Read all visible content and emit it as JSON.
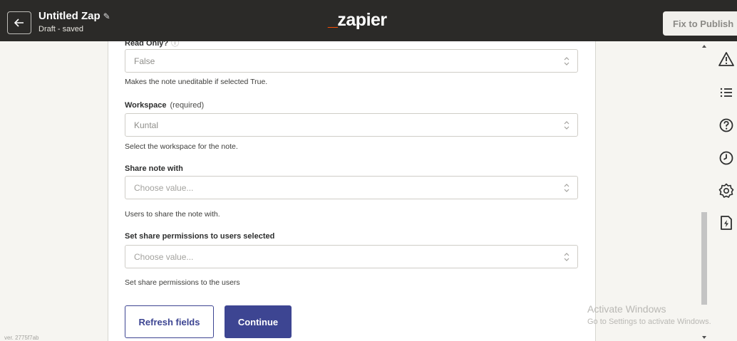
{
  "header": {
    "zap_title": "Untitled Zap",
    "zap_status": "Draft - saved",
    "logo_prefix": "_",
    "logo_text": "zapier",
    "publish_label": "Fix to Publish"
  },
  "form": {
    "read_only": {
      "label": "Read Only?",
      "value": "False",
      "help": "Makes the note uneditable if selected True."
    },
    "workspace": {
      "label": "Workspace",
      "required": "(required)",
      "value": "Kuntal",
      "help": "Select the workspace for the note."
    },
    "share_with": {
      "label": "Share note with",
      "placeholder": "Choose value...",
      "help": "Users to share the note with."
    },
    "share_permissions": {
      "label": "Set share permissions to users selected",
      "placeholder": "Choose value...",
      "help": "Set share permissions to the users"
    }
  },
  "buttons": {
    "refresh": "Refresh fields",
    "continue": "Continue"
  },
  "rail_icons": [
    "warning-icon",
    "list-icon",
    "help-icon",
    "history-icon",
    "settings-icon",
    "zap-file-icon"
  ],
  "footer": {
    "version": "ver. 2775f7ab"
  },
  "watermark": {
    "line1": "Activate Windows",
    "line2": "Go to Settings to activate Windows."
  },
  "colors": {
    "topbar": "#2b2a28",
    "accent": "#3d4592",
    "brand_orange": "#ff4f00"
  }
}
